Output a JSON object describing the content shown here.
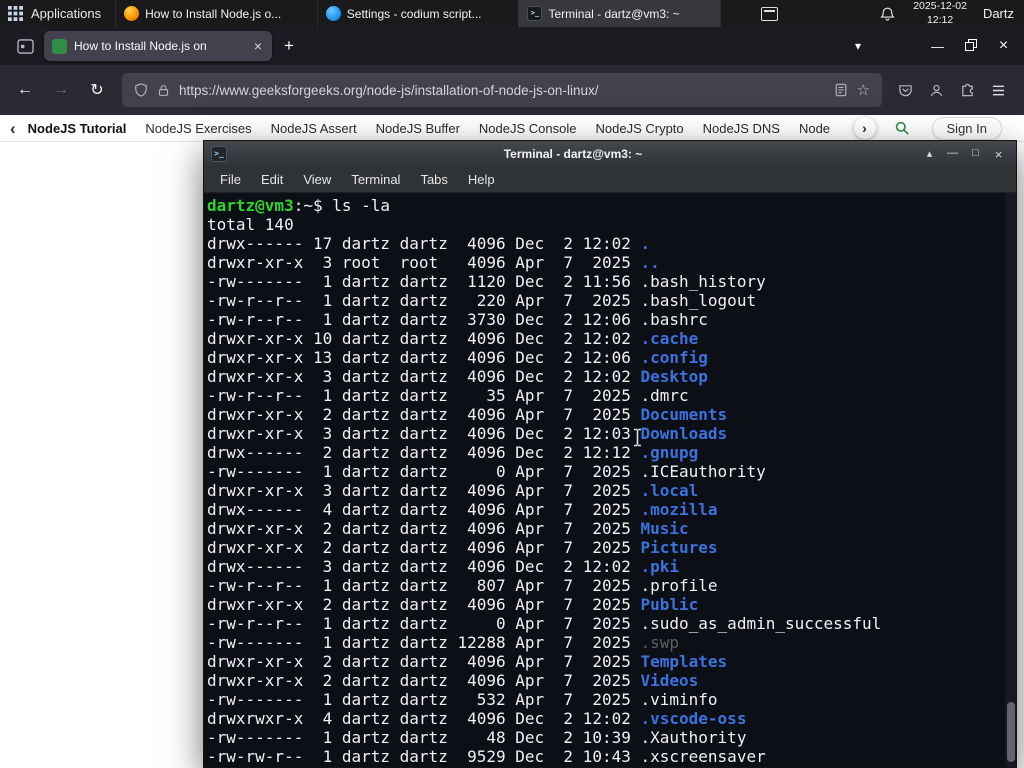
{
  "colors": {
    "accent_green": "#2f8d46",
    "term_fg": "#f1f1f1",
    "term_prompt": "#2fd42f",
    "term_dir": "#3c72dd",
    "term_dim": "#5e6062"
  },
  "icons": {
    "plus": "+",
    "close": "×",
    "minimize": "—",
    "maximize": "□",
    "shade": "▴",
    "chevron_down": "▾",
    "chevron_left": "‹",
    "chevron_right": "›",
    "back": "←",
    "forward": "→",
    "reload": "↻",
    "star": "☆",
    "terminal_glyph": ">_"
  },
  "panel": {
    "applications": "Applications",
    "tasks": [
      {
        "icon": "firefox",
        "title": "How to Install Node.js o...",
        "active": false
      },
      {
        "icon": "codium",
        "title": "Settings - codium script...",
        "active": false
      },
      {
        "icon": "terminal",
        "title": "Terminal - dartz@vm3: ~",
        "active": true
      }
    ],
    "date": "2025-12-02",
    "time": "12:12",
    "user": "Dartz"
  },
  "firefox": {
    "tab": {
      "title": "How to Install Node.js on"
    },
    "url": "https://www.geeksforgeeks.org/node-js/installation-of-node-js-on-linux/"
  },
  "gfg": {
    "items": [
      {
        "label": "NodeJS Tutorial",
        "bold": true
      },
      {
        "label": "NodeJS Exercises",
        "bold": false
      },
      {
        "label": "NodeJS Assert",
        "bold": false
      },
      {
        "label": "NodeJS Buffer",
        "bold": false
      },
      {
        "label": "NodeJS Console",
        "bold": false
      },
      {
        "label": "NodeJS Crypto",
        "bold": false
      },
      {
        "label": "NodeJS DNS",
        "bold": false
      },
      {
        "label": "Node",
        "bold": false
      }
    ],
    "sign_in": "Sign In"
  },
  "terminal": {
    "title": "Terminal - dartz@vm3: ~",
    "menu": [
      "File",
      "Edit",
      "View",
      "Terminal",
      "Tabs",
      "Help"
    ],
    "prompt": "dartz@vm3",
    "prompt_suffix": ":~$ ",
    "command": "ls -la",
    "total": "total 140",
    "files": [
      {
        "pre": "drwx------ 17 dartz dartz  4096 Dec  2 12:02 ",
        "name": ".",
        "c": "dir"
      },
      {
        "pre": "drwxr-xr-x  3 root  root   4096 Apr  7  2025 ",
        "name": "..",
        "c": "dir"
      },
      {
        "pre": "-rw-------  1 dartz dartz  1120 Dec  2 11:56 ",
        "name": ".bash_history",
        "c": "file"
      },
      {
        "pre": "-rw-r--r--  1 dartz dartz   220 Apr  7  2025 ",
        "name": ".bash_logout",
        "c": "file"
      },
      {
        "pre": "-rw-r--r--  1 dartz dartz  3730 Dec  2 12:06 ",
        "name": ".bashrc",
        "c": "file"
      },
      {
        "pre": "drwxr-xr-x 10 dartz dartz  4096 Dec  2 12:02 ",
        "name": ".cache",
        "c": "dir"
      },
      {
        "pre": "drwxr-xr-x 13 dartz dartz  4096 Dec  2 12:06 ",
        "name": ".config",
        "c": "dir"
      },
      {
        "pre": "drwxr-xr-x  3 dartz dartz  4096 Dec  2 12:02 ",
        "name": "Desktop",
        "c": "dir"
      },
      {
        "pre": "-rw-r--r--  1 dartz dartz    35 Apr  7  2025 ",
        "name": ".dmrc",
        "c": "file"
      },
      {
        "pre": "drwxr-xr-x  2 dartz dartz  4096 Apr  7  2025 ",
        "name": "Documents",
        "c": "dir"
      },
      {
        "pre": "drwxr-xr-x  3 dartz dartz  4096 Dec  2 12:03 ",
        "name": "Downloads",
        "c": "dir"
      },
      {
        "pre": "drwx------  2 dartz dartz  4096 Dec  2 12:12 ",
        "name": ".gnupg",
        "c": "dir"
      },
      {
        "pre": "-rw-------  1 dartz dartz     0 Apr  7  2025 ",
        "name": ".ICEauthority",
        "c": "file"
      },
      {
        "pre": "drwxr-xr-x  3 dartz dartz  4096 Apr  7  2025 ",
        "name": ".local",
        "c": "dir"
      },
      {
        "pre": "drwx------  4 dartz dartz  4096 Apr  7  2025 ",
        "name": ".mozilla",
        "c": "dir"
      },
      {
        "pre": "drwxr-xr-x  2 dartz dartz  4096 Apr  7  2025 ",
        "name": "Music",
        "c": "dir"
      },
      {
        "pre": "drwxr-xr-x  2 dartz dartz  4096 Apr  7  2025 ",
        "name": "Pictures",
        "c": "dir"
      },
      {
        "pre": "drwx------  3 dartz dartz  4096 Dec  2 12:02 ",
        "name": ".pki",
        "c": "dir"
      },
      {
        "pre": "-rw-r--r--  1 dartz dartz   807 Apr  7  2025 ",
        "name": ".profile",
        "c": "file"
      },
      {
        "pre": "drwxr-xr-x  2 dartz dartz  4096 Apr  7  2025 ",
        "name": "Public",
        "c": "dir"
      },
      {
        "pre": "-rw-r--r--  1 dartz dartz     0 Apr  7  2025 ",
        "name": ".sudo_as_admin_successful",
        "c": "file"
      },
      {
        "pre": "-rw-------  1 dartz dartz 12288 Apr  7  2025 ",
        "name": ".swp",
        "c": "dim"
      },
      {
        "pre": "drwxr-xr-x  2 dartz dartz  4096 Apr  7  2025 ",
        "name": "Templates",
        "c": "dir"
      },
      {
        "pre": "drwxr-xr-x  2 dartz dartz  4096 Apr  7  2025 ",
        "name": "Videos",
        "c": "dir"
      },
      {
        "pre": "-rw-------  1 dartz dartz   532 Apr  7  2025 ",
        "name": ".viminfo",
        "c": "file"
      },
      {
        "pre": "drwxrwxr-x  4 dartz dartz  4096 Dec  2 12:02 ",
        "name": ".vscode-oss",
        "c": "dir"
      },
      {
        "pre": "-rw-------  1 dartz dartz    48 Dec  2 10:39 ",
        "name": ".Xauthority",
        "c": "file"
      },
      {
        "pre": "-rw-rw-r--  1 dartz dartz  9529 Dec  2 10:43 ",
        "name": ".xscreensaver",
        "c": "file"
      }
    ]
  }
}
